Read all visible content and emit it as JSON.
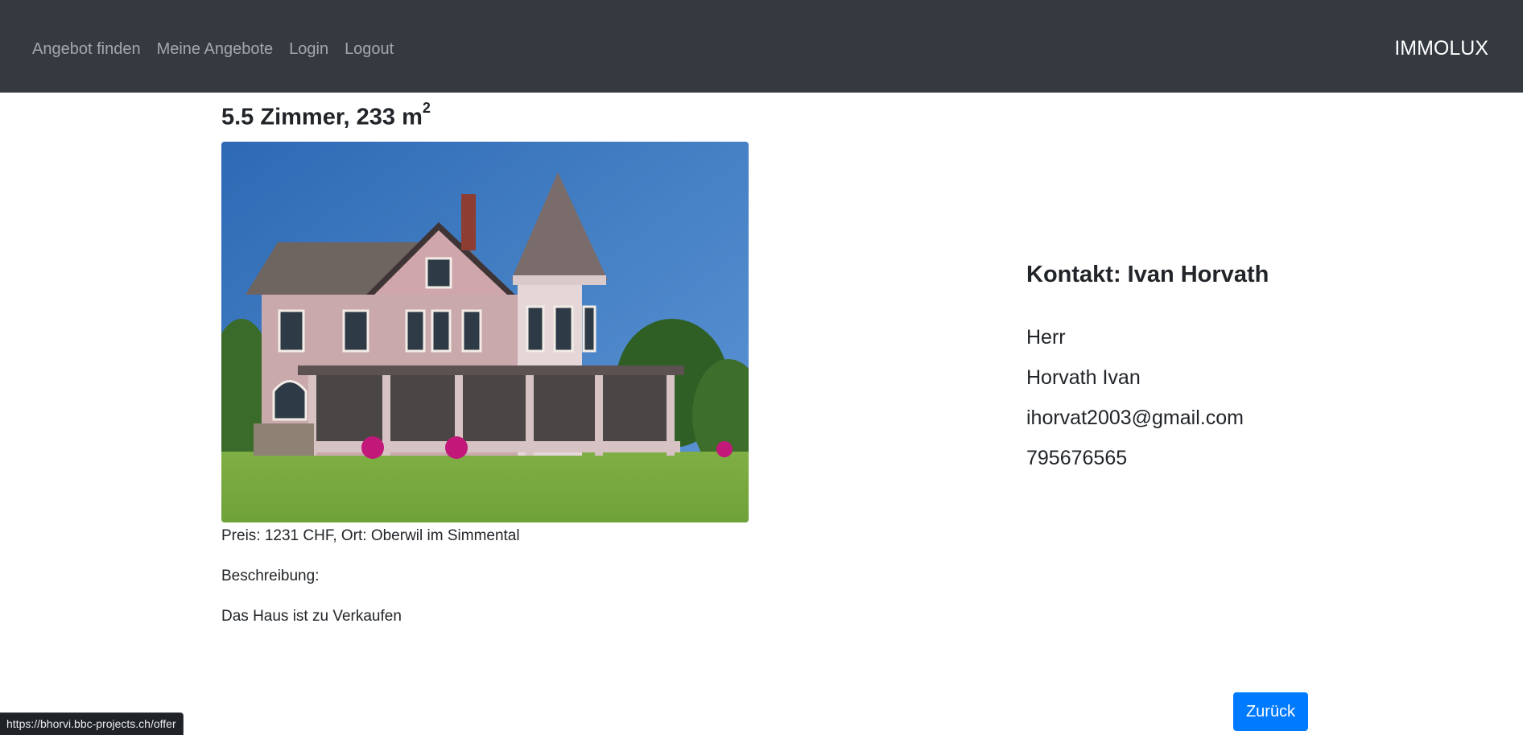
{
  "nav": {
    "links": [
      "Angebot finden",
      "Meine Angebote",
      "Login",
      "Logout"
    ],
    "brand": "IMMOLUX"
  },
  "offer": {
    "title": "5.5 Zimmer, 233 m",
    "title_sup": "2",
    "price_location": "Preis: 1231 CHF, Ort: Oberwil im Simmental",
    "description_label": "Beschreibung:",
    "description": "Das Haus ist zu Verkaufen"
  },
  "contact": {
    "title": "Kontakt: Ivan Horvath",
    "salutation": "Herr",
    "name": "Horvath Ivan",
    "email": "ihorvat2003@gmail.com",
    "phone": "795676565"
  },
  "back_button": "Zurück",
  "status_url": "https://bhorvi.bbc-projects.ch/offer",
  "colors": {
    "navbar": "#343a40",
    "accent": "#007bff"
  }
}
